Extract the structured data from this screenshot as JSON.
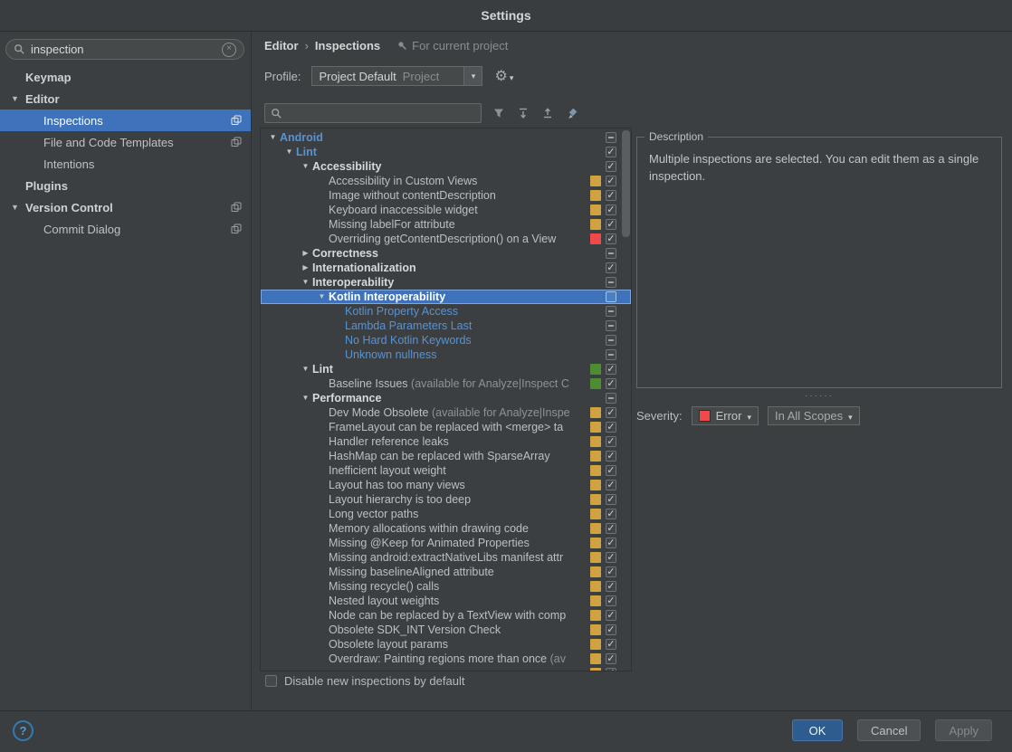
{
  "window": {
    "title": "Settings"
  },
  "colors": {
    "selection": "#3e72ba",
    "yellow": "#d0a240",
    "red": "#ef4949",
    "green": "#4e8c30"
  },
  "icons": [
    "search-icon",
    "clear-icon",
    "filter-icon",
    "expand-all-icon",
    "collapse-all-icon",
    "reset-icon",
    "gear-icon",
    "pin-icon",
    "help-icon",
    "project-settings-badge-icon",
    "chevron-down-icon",
    "chevron-right-icon"
  ],
  "sidebar": {
    "search": {
      "value": "inspection"
    },
    "items": [
      {
        "label": "Keymap",
        "indent": 1,
        "bold": true
      },
      {
        "label": "Editor",
        "indent": 0,
        "bold": true,
        "arrow": "down"
      },
      {
        "label": "Inspections",
        "indent": 2,
        "selected": true,
        "badge": true
      },
      {
        "label": "File and Code Templates",
        "indent": 2,
        "badge": true
      },
      {
        "label": "Intentions",
        "indent": 2
      },
      {
        "label": "Plugins",
        "indent": 1,
        "bold": true
      },
      {
        "label": "Version Control",
        "indent": 0,
        "bold": true,
        "arrow": "down",
        "badge": true
      },
      {
        "label": "Commit Dialog",
        "indent": 2,
        "badge": true
      }
    ]
  },
  "header": {
    "breadcrumb": [
      "Editor",
      "Inspections"
    ],
    "scope_note": "For current project",
    "profile_label": "Profile:",
    "profile_value": "Project Default",
    "profile_hint": "Project"
  },
  "toolbar": {
    "search_value": ""
  },
  "tree": {
    "rows": [
      {
        "indent": 0,
        "arrow": "down",
        "label": "Android",
        "style": "blue-bold",
        "check": "dash"
      },
      {
        "indent": 1,
        "arrow": "down",
        "label": "Lint",
        "style": "blue-bold",
        "check": "check"
      },
      {
        "indent": 2,
        "arrow": "down",
        "label": "Accessibility",
        "style": "group",
        "check": "check"
      },
      {
        "indent": 3,
        "label": "Accessibility in Custom Views",
        "severity": "yellow",
        "check": "check"
      },
      {
        "indent": 3,
        "label": "Image without contentDescription",
        "severity": "yellow",
        "check": "check"
      },
      {
        "indent": 3,
        "label": "Keyboard inaccessible widget",
        "severity": "yellow",
        "check": "check"
      },
      {
        "indent": 3,
        "label": "Missing labelFor attribute",
        "severity": "yellow",
        "check": "check"
      },
      {
        "indent": 3,
        "label": "Overriding getContentDescription() on a View",
        "severity": "red",
        "check": "check"
      },
      {
        "indent": 2,
        "arrow": "right",
        "label": "Correctness",
        "style": "group",
        "check": "dash"
      },
      {
        "indent": 2,
        "arrow": "right",
        "label": "Internationalization",
        "style": "group",
        "check": "check"
      },
      {
        "indent": 2,
        "arrow": "down",
        "label": "Interoperability",
        "style": "group",
        "check": "dash"
      },
      {
        "indent": 3,
        "arrow": "down",
        "label": "Kotlin Interoperability",
        "style": "group",
        "check": "empty",
        "selected": true
      },
      {
        "indent": 4,
        "label": "Kotlin Property Access",
        "style": "blue",
        "check": "dash"
      },
      {
        "indent": 4,
        "label": "Lambda Parameters Last",
        "style": "blue",
        "check": "dash"
      },
      {
        "indent": 4,
        "label": "No Hard Kotlin Keywords",
        "style": "blue",
        "check": "dash"
      },
      {
        "indent": 4,
        "label": "Unknown nullness",
        "style": "blue",
        "check": "dash"
      },
      {
        "indent": 2,
        "arrow": "down",
        "label": "Lint",
        "style": "group",
        "severity": "green",
        "check": "check"
      },
      {
        "indent": 3,
        "label": "Baseline Issues",
        "note": "(available for Analyze|Inspect C",
        "severity": "green",
        "check": "check"
      },
      {
        "indent": 2,
        "arrow": "down",
        "label": "Performance",
        "style": "group",
        "check": "dash"
      },
      {
        "indent": 3,
        "label": "Dev Mode Obsolete",
        "note": "(available for Analyze|Inspe",
        "severity": "yellow",
        "check": "check"
      },
      {
        "indent": 3,
        "label": "FrameLayout can be replaced with <merge> ta",
        "severity": "yellow",
        "check": "check"
      },
      {
        "indent": 3,
        "label": "Handler reference leaks",
        "severity": "yellow",
        "check": "check"
      },
      {
        "indent": 3,
        "label": "HashMap can be replaced with SparseArray",
        "severity": "yellow",
        "check": "check"
      },
      {
        "indent": 3,
        "label": "Inefficient layout weight",
        "severity": "yellow",
        "check": "check"
      },
      {
        "indent": 3,
        "label": "Layout has too many views",
        "severity": "yellow",
        "check": "check"
      },
      {
        "indent": 3,
        "label": "Layout hierarchy is too deep",
        "severity": "yellow",
        "check": "check"
      },
      {
        "indent": 3,
        "label": "Long vector paths",
        "severity": "yellow",
        "check": "check"
      },
      {
        "indent": 3,
        "label": "Memory allocations within drawing code",
        "severity": "yellow",
        "check": "check"
      },
      {
        "indent": 3,
        "label": "Missing @Keep for Animated Properties",
        "severity": "yellow",
        "check": "check"
      },
      {
        "indent": 3,
        "label": "Missing android:extractNativeLibs manifest attr",
        "severity": "yellow",
        "check": "check"
      },
      {
        "indent": 3,
        "label": "Missing baselineAligned attribute",
        "severity": "yellow",
        "check": "check"
      },
      {
        "indent": 3,
        "label": "Missing recycle() calls",
        "severity": "yellow",
        "check": "check"
      },
      {
        "indent": 3,
        "label": "Nested layout weights",
        "severity": "yellow",
        "check": "check"
      },
      {
        "indent": 3,
        "label": "Node can be replaced by a TextView with comp",
        "severity": "yellow",
        "check": "check"
      },
      {
        "indent": 3,
        "label": "Obsolete SDK_INT Version Check",
        "severity": "yellow",
        "check": "check"
      },
      {
        "indent": 3,
        "label": "Obsolete layout params",
        "severity": "yellow",
        "check": "check"
      },
      {
        "indent": 3,
        "label": "Overdraw: Painting regions more than once",
        "note": "(av",
        "severity": "yellow",
        "check": "check"
      },
      {
        "indent": 3,
        "label": "",
        "severity": "yellow",
        "check": "check"
      }
    ]
  },
  "description": {
    "title": "Description",
    "text": "Multiple inspections are selected. You can edit them as a single inspection."
  },
  "severity": {
    "label": "Severity:",
    "value": "Error",
    "scope": "In All Scopes"
  },
  "options": {
    "disable_new_label": "Disable new inspections by default",
    "disable_new_checked": false
  },
  "footer": {
    "help": "?",
    "ok": "OK",
    "cancel": "Cancel",
    "apply": "Apply"
  }
}
